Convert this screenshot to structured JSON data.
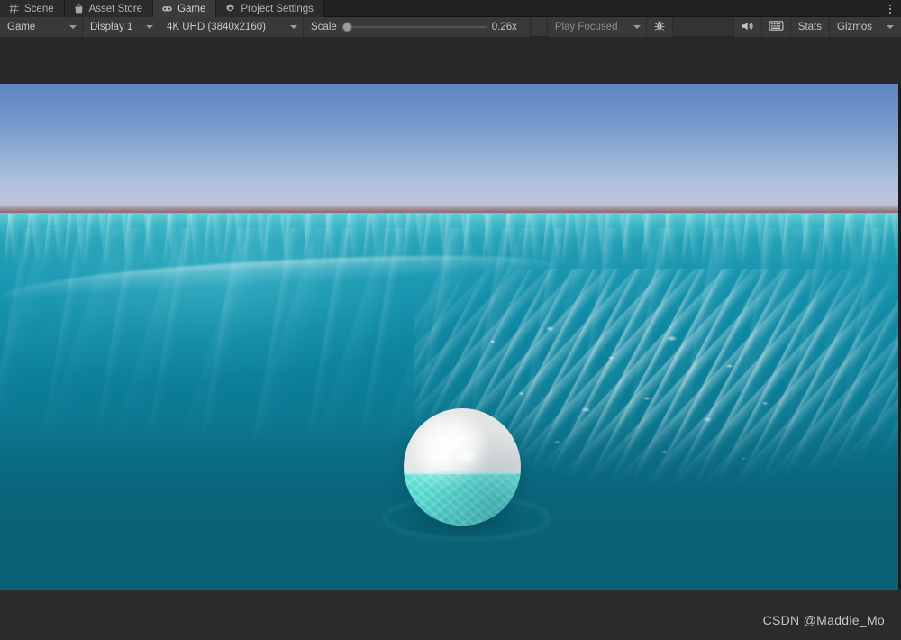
{
  "window": {
    "tabs": [
      {
        "label": "Scene",
        "icon": "grid-icon",
        "active": false
      },
      {
        "label": "Asset Store",
        "icon": "shopping-bag-icon",
        "active": false
      },
      {
        "label": "Game",
        "icon": "gamepad-icon",
        "active": true
      },
      {
        "label": "Project Settings",
        "icon": "gear-icon",
        "active": false
      }
    ],
    "overflow_menu": "kebab-menu"
  },
  "toolbar": {
    "view_mode": "Game",
    "display": "Display 1",
    "resolution": "4K UHD (3840x2160)",
    "scale_label": "Scale",
    "scale_value": "0.26x",
    "scale_position_percent": 0,
    "play_mode": "Play Focused",
    "debug_icon": "bug-icon",
    "mute_audio_icon": "speaker-icon",
    "stats_grid_icon": "grid-overlay-icon",
    "stats_label": "Stats",
    "gizmos_label": "Gizmos",
    "search_value": ""
  },
  "game_view": {
    "watermark": "CSDN @Maddie_Mo",
    "scene_description": "Floating white sphere buoy on a turquoise ocean under a clear blue sky",
    "colors": {
      "sky_top": "#5d86c4",
      "sky_horizon": "#c3c1d2",
      "haze_band": "#96788 4",
      "sea_far": "#3fb6c4",
      "sea_near": "#0a6175",
      "ball_top": "#ffffff",
      "ball_submerged": "#5ce2d6",
      "letterbox": "#282828"
    }
  }
}
